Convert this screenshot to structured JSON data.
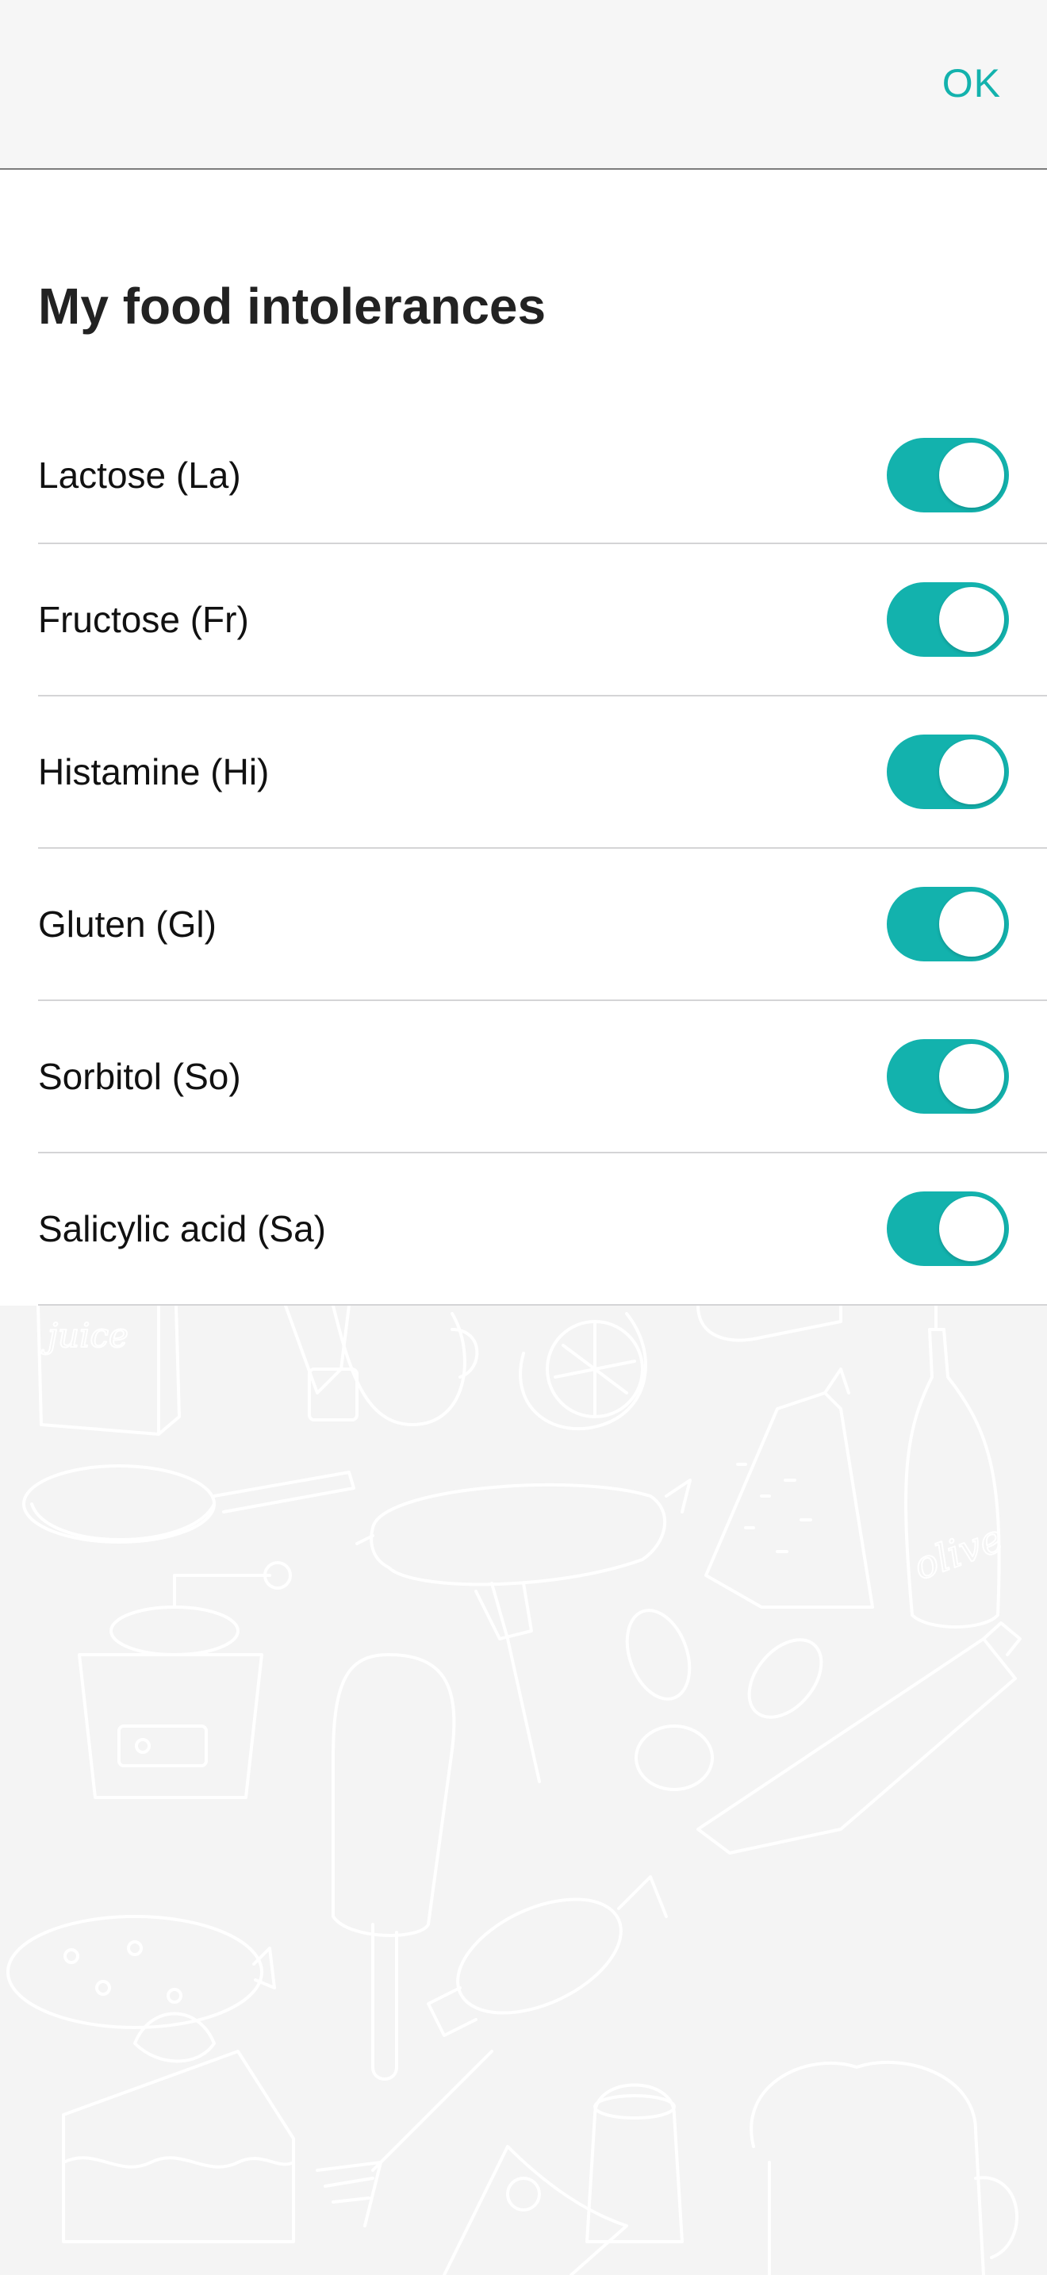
{
  "navbar": {
    "ok_label": "OK"
  },
  "title": "My food intolerances",
  "items": [
    {
      "label": "Lactose (La)",
      "enabled": true
    },
    {
      "label": "Fructose (Fr)",
      "enabled": true
    },
    {
      "label": "Histamine (Hi)",
      "enabled": true
    },
    {
      "label": "Gluten (Gl)",
      "enabled": true
    },
    {
      "label": "Sorbitol (So)",
      "enabled": true
    },
    {
      "label": "Salicylic acid (Sa)",
      "enabled": true
    }
  ],
  "colors": {
    "accent": "#13b2ad",
    "background": "#f4f4f4",
    "panel": "#ffffff"
  },
  "background": {
    "art_lettering": [
      "juice",
      "olive"
    ]
  }
}
